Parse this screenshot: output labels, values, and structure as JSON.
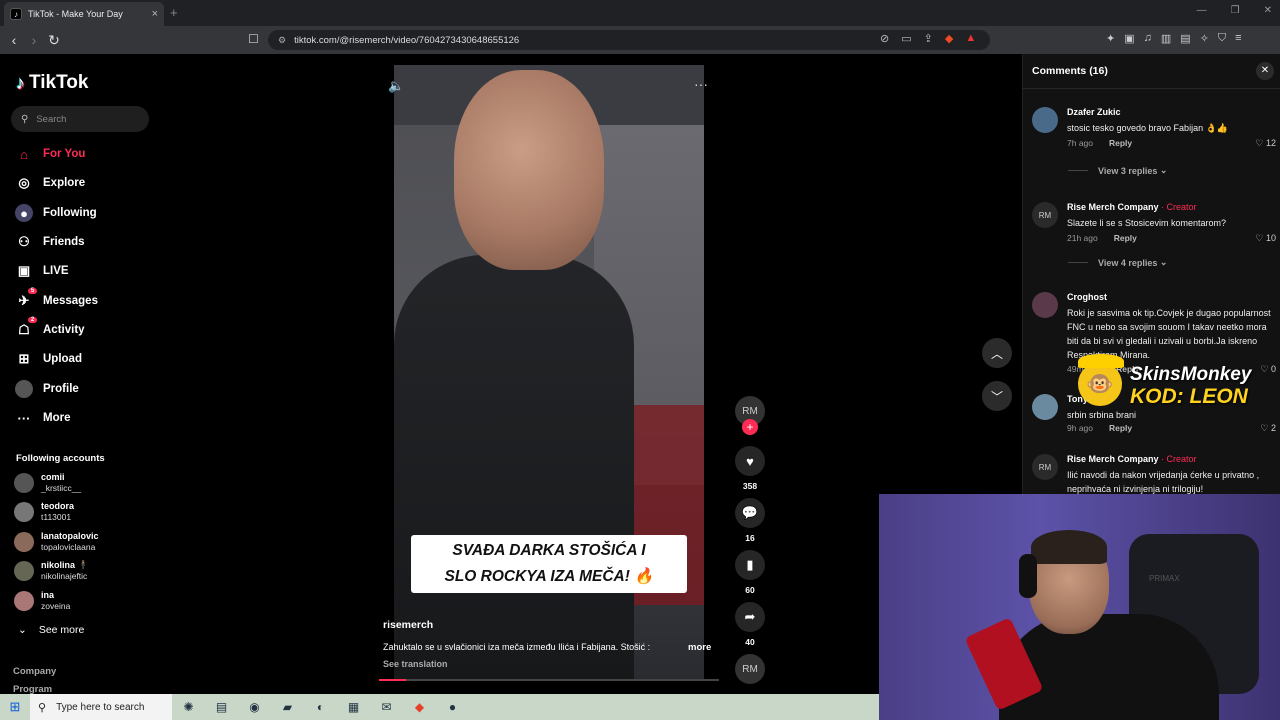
{
  "browser": {
    "tab_title": "TikTok - Make Your Day",
    "tab_close": "×",
    "new_tab": "+",
    "url": "tiktok.com/@risemerch/video/7604273430648655126",
    "window_controls": [
      "—",
      "❐",
      "✕"
    ]
  },
  "sidebar": {
    "logo": "TikTok",
    "search_placeholder": "Search",
    "nav": [
      {
        "label": "For You",
        "icon": "home-icon",
        "active": true
      },
      {
        "label": "Explore",
        "icon": "compass-icon"
      },
      {
        "label": "Following",
        "icon": "following-icon"
      },
      {
        "label": "Friends",
        "icon": "friends-icon"
      },
      {
        "label": "LIVE",
        "icon": "live-icon"
      },
      {
        "label": "Messages",
        "icon": "messages-icon",
        "badge": "5"
      },
      {
        "label": "Activity",
        "icon": "activity-icon",
        "badge": "2"
      },
      {
        "label": "Upload",
        "icon": "upload-icon"
      },
      {
        "label": "Profile",
        "icon": "profile-icon"
      },
      {
        "label": "More",
        "icon": "more-icon"
      }
    ],
    "following_title": "Following accounts",
    "accounts": [
      {
        "name": "comii",
        "user": "_krstiicc__"
      },
      {
        "name": "teodora",
        "user": "t113001"
      },
      {
        "name": "lanatopalovic",
        "user": "topaloviclaana"
      },
      {
        "name": "nikolina 🕴",
        "user": "nikolinajeftic"
      },
      {
        "name": "ina",
        "user": "zoveina"
      }
    ],
    "see_more": "See more",
    "footer_company": "Company",
    "footer_program": "Program"
  },
  "video": {
    "caption_line1": "SVAĐA DARKA STOŠIĆA I",
    "caption_line2": "SLO ROCKYA IZA MEČA! 🔥",
    "username": "risemerch",
    "description": "Zahuktalo se u svlačionici iza meča između Ilića i Fabijana. Stošić :",
    "more": "more",
    "see_translation": "See translation",
    "progress": 0.08
  },
  "actions": {
    "likes": "358",
    "comments": "16",
    "saves": "60",
    "shares": "40"
  },
  "comments": {
    "title": "Comments",
    "count": "(16)",
    "items": [
      {
        "name": "Dzafer Zukic",
        "creator": "",
        "text": "stosic tesko govedo bravo Fabijan 👌👍",
        "time": "7h ago",
        "reply": "Reply",
        "likes": "12",
        "view_replies": "View 3 replies"
      },
      {
        "name": "Rise Merch Company",
        "creator": " · Creator",
        "text": "Slazete li se s Stosicevim komentarom?",
        "time": "21h ago",
        "reply": "Reply",
        "likes": "10",
        "view_replies": "View 4 replies"
      },
      {
        "name": "Croghost",
        "creator": "",
        "text": "Roki je sasvima ok tip.Covjek je dugao popularnost FNC u nebo sa svojim souom I takav neetko mora biti da bi svi vi gledali i uzivali u borbi.Ja iskreno Respektiram Mirana.",
        "time": "49m ago",
        "reply": "Reply",
        "likes": "0"
      },
      {
        "name": "Tony",
        "creator": "",
        "text": "srbin srbina brani",
        "time": "9h ago",
        "reply": "Reply",
        "likes": "2"
      },
      {
        "name": "Rise Merch Company",
        "creator": " · Creator",
        "text": "Ilić navodi da nakon vrijedanja ćerke u privatno , neprihvaća ni izvinjenja ni trilogiju!",
        "time": "",
        "reply": "",
        "likes": ""
      }
    ]
  },
  "ad_overlay": {
    "line1": "SkinsMonkey",
    "line2": "KOD: LEON"
  },
  "webcam": {
    "chair_text": "PRIMAX"
  },
  "taskbar": {
    "search_placeholder": "Type here to search"
  },
  "colors": {
    "accent": "#fe2c55",
    "bg": "#000000",
    "panel": "#121212"
  }
}
